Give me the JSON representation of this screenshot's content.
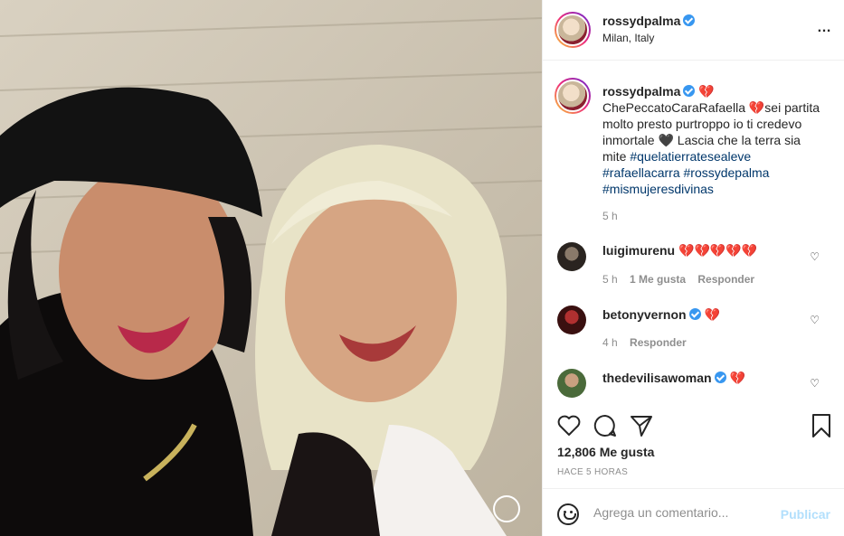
{
  "post": {
    "username": "rossydpalma",
    "location": "Milan, Italy",
    "more_icon": "…"
  },
  "caption": {
    "username": "rossydpalma",
    "broken_heart": "💔",
    "line1": "ChePeccatoCaraRafaella 💔sei partita molto presto purtroppo io ti credevo inmortale 🖤 Lascia che la terra sia mite ",
    "tag1": "#quelatierratesealeve",
    "tag2": "#rafaellacarra",
    "tag3": "#rossydepalma",
    "tag4": "#mismujeresdivinas",
    "time": "5 h"
  },
  "comments": [
    {
      "username": "luigimurenu",
      "text": "💔💔💔💔💔",
      "time": "5 h",
      "likes": "1 Me gusta",
      "reply": "Responder"
    },
    {
      "username": "betonyvernon",
      "text": "💔",
      "time": "4 h",
      "reply": "Responder"
    },
    {
      "username": "thedevilisawoman",
      "text": "💔"
    }
  ],
  "likes": "12,806 Me gusta",
  "timestamp": "HACE 5 HORAS",
  "comment_box": {
    "placeholder": "Agrega un comentario...",
    "publish": "Publicar"
  },
  "colors": {
    "verified": "#3897f0",
    "hashtag": "#00376b",
    "publish_disabled": "#b2dffc"
  }
}
